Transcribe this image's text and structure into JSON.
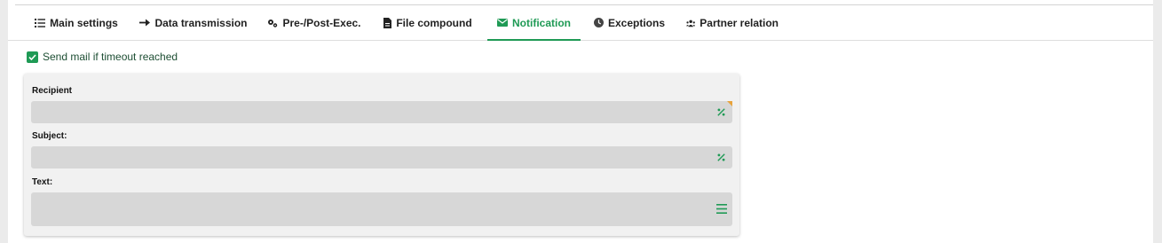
{
  "tabs": [
    {
      "label": "Main settings",
      "icon": "list-icon"
    },
    {
      "label": "Data transmission",
      "icon": "arrow-right-icon"
    },
    {
      "label": "Pre-/Post-Exec.",
      "icon": "gears-icon"
    },
    {
      "label": "File compound",
      "icon": "file-icon"
    },
    {
      "label": "Notification",
      "icon": "envelope-icon",
      "active": true
    },
    {
      "label": "Exceptions",
      "icon": "clock-icon"
    },
    {
      "label": "Partner relation",
      "icon": "partners-icon"
    }
  ],
  "timeout_mail": {
    "checked": true,
    "label": "Send mail if timeout reached"
  },
  "form": {
    "recipient": {
      "label": "Recipient",
      "value": "",
      "icon": "percent-variable-icon"
    },
    "subject": {
      "label": "Subject:",
      "value": "",
      "icon": "percent-variable-icon"
    },
    "text": {
      "label": "Text:",
      "value": "",
      "icon": "menu-lines-icon"
    }
  },
  "colors": {
    "accent": "#1f9a55",
    "field_bg": "#d7d7d7",
    "panel_bg": "#f1f1f1",
    "required_marker": "#e8a33c"
  }
}
